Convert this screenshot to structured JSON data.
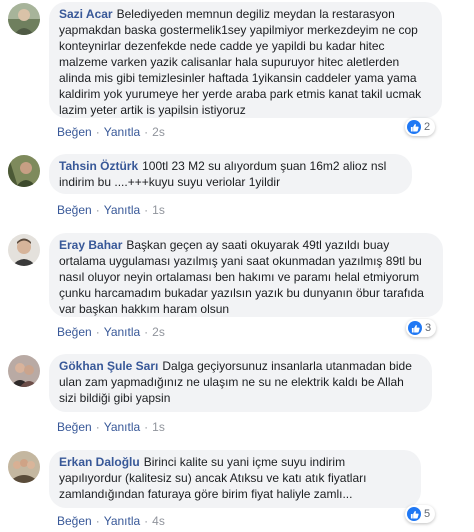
{
  "actions": {
    "like": "Beğen",
    "reply": "Yanıtla",
    "separator": "·"
  },
  "comments": [
    {
      "author": "Sazi Acar",
      "text": "Belediyeden memnun degiliz meydan la restarasyon yapmakdan baska gostermelik1sey yapilmiyor merkezdeyim ne cop konteynirlar dezenfekde nede cadde ye yapildi bu kadar hitec malzeme varken yazik calisanlar hala supuruyor hitec aletlerden alinda mis gibi temizlesinler haftada 1yikansin caddeler yama yama kaldirim yok yurumeye her yerde araba park etmis kanat takil ucmak lazim yeter artik is yapilsin istiyoruz",
      "time": "2s",
      "reactions": "2",
      "avatar_color": "#8a9a7a"
    },
    {
      "author": "Tahsin Öztürk",
      "text": "100tl 23 M2 su alıyordum şuan 16m2 alioz nsl indirim bu ....+++kuyu suyu veriolar 1yildir",
      "time": "1s",
      "reactions": "",
      "avatar_color": "#5f6b4c"
    },
    {
      "author": "Eray Bahar",
      "text": "Başkan geçen ay saati okuyarak 49tl yazıldı buay ortalama uygulaması yazılmış yani saat okunmadan yazılmış 89tl bu nasıl oluyor neyin ortalaması ben hakımı ve paramı helal etmiyorum çunku harcamadım bukadar yazılsın yazık bu dunyanın öbur tarafıda var başkan hakkım haram olsun",
      "time": "2s",
      "reactions": "3",
      "avatar_color": "#c8b8a6"
    },
    {
      "author": "Gökhan Şule Sarı",
      "text": "Dalga geçiyorsunuz insanlarla utanmadan bide ulan zam yapmadığınız ne ulaşım ne su ne elektrik kaldı be Allah sizi bildiği gibi yapsin",
      "time": "1s",
      "reactions": "",
      "avatar_color": "#7a6a66"
    },
    {
      "author": "Erkan Daloğlu",
      "text": "Birinci kalite su yani içme suyu indirim yapılıyordur (kalitesiz su) ancak Atıksu ve katı atık fiyatları zamlandığından faturaya göre birim fiyat haliyle zamlı...",
      "time": "4s",
      "reactions": "5",
      "avatar_color": "#9a8a6e"
    }
  ]
}
